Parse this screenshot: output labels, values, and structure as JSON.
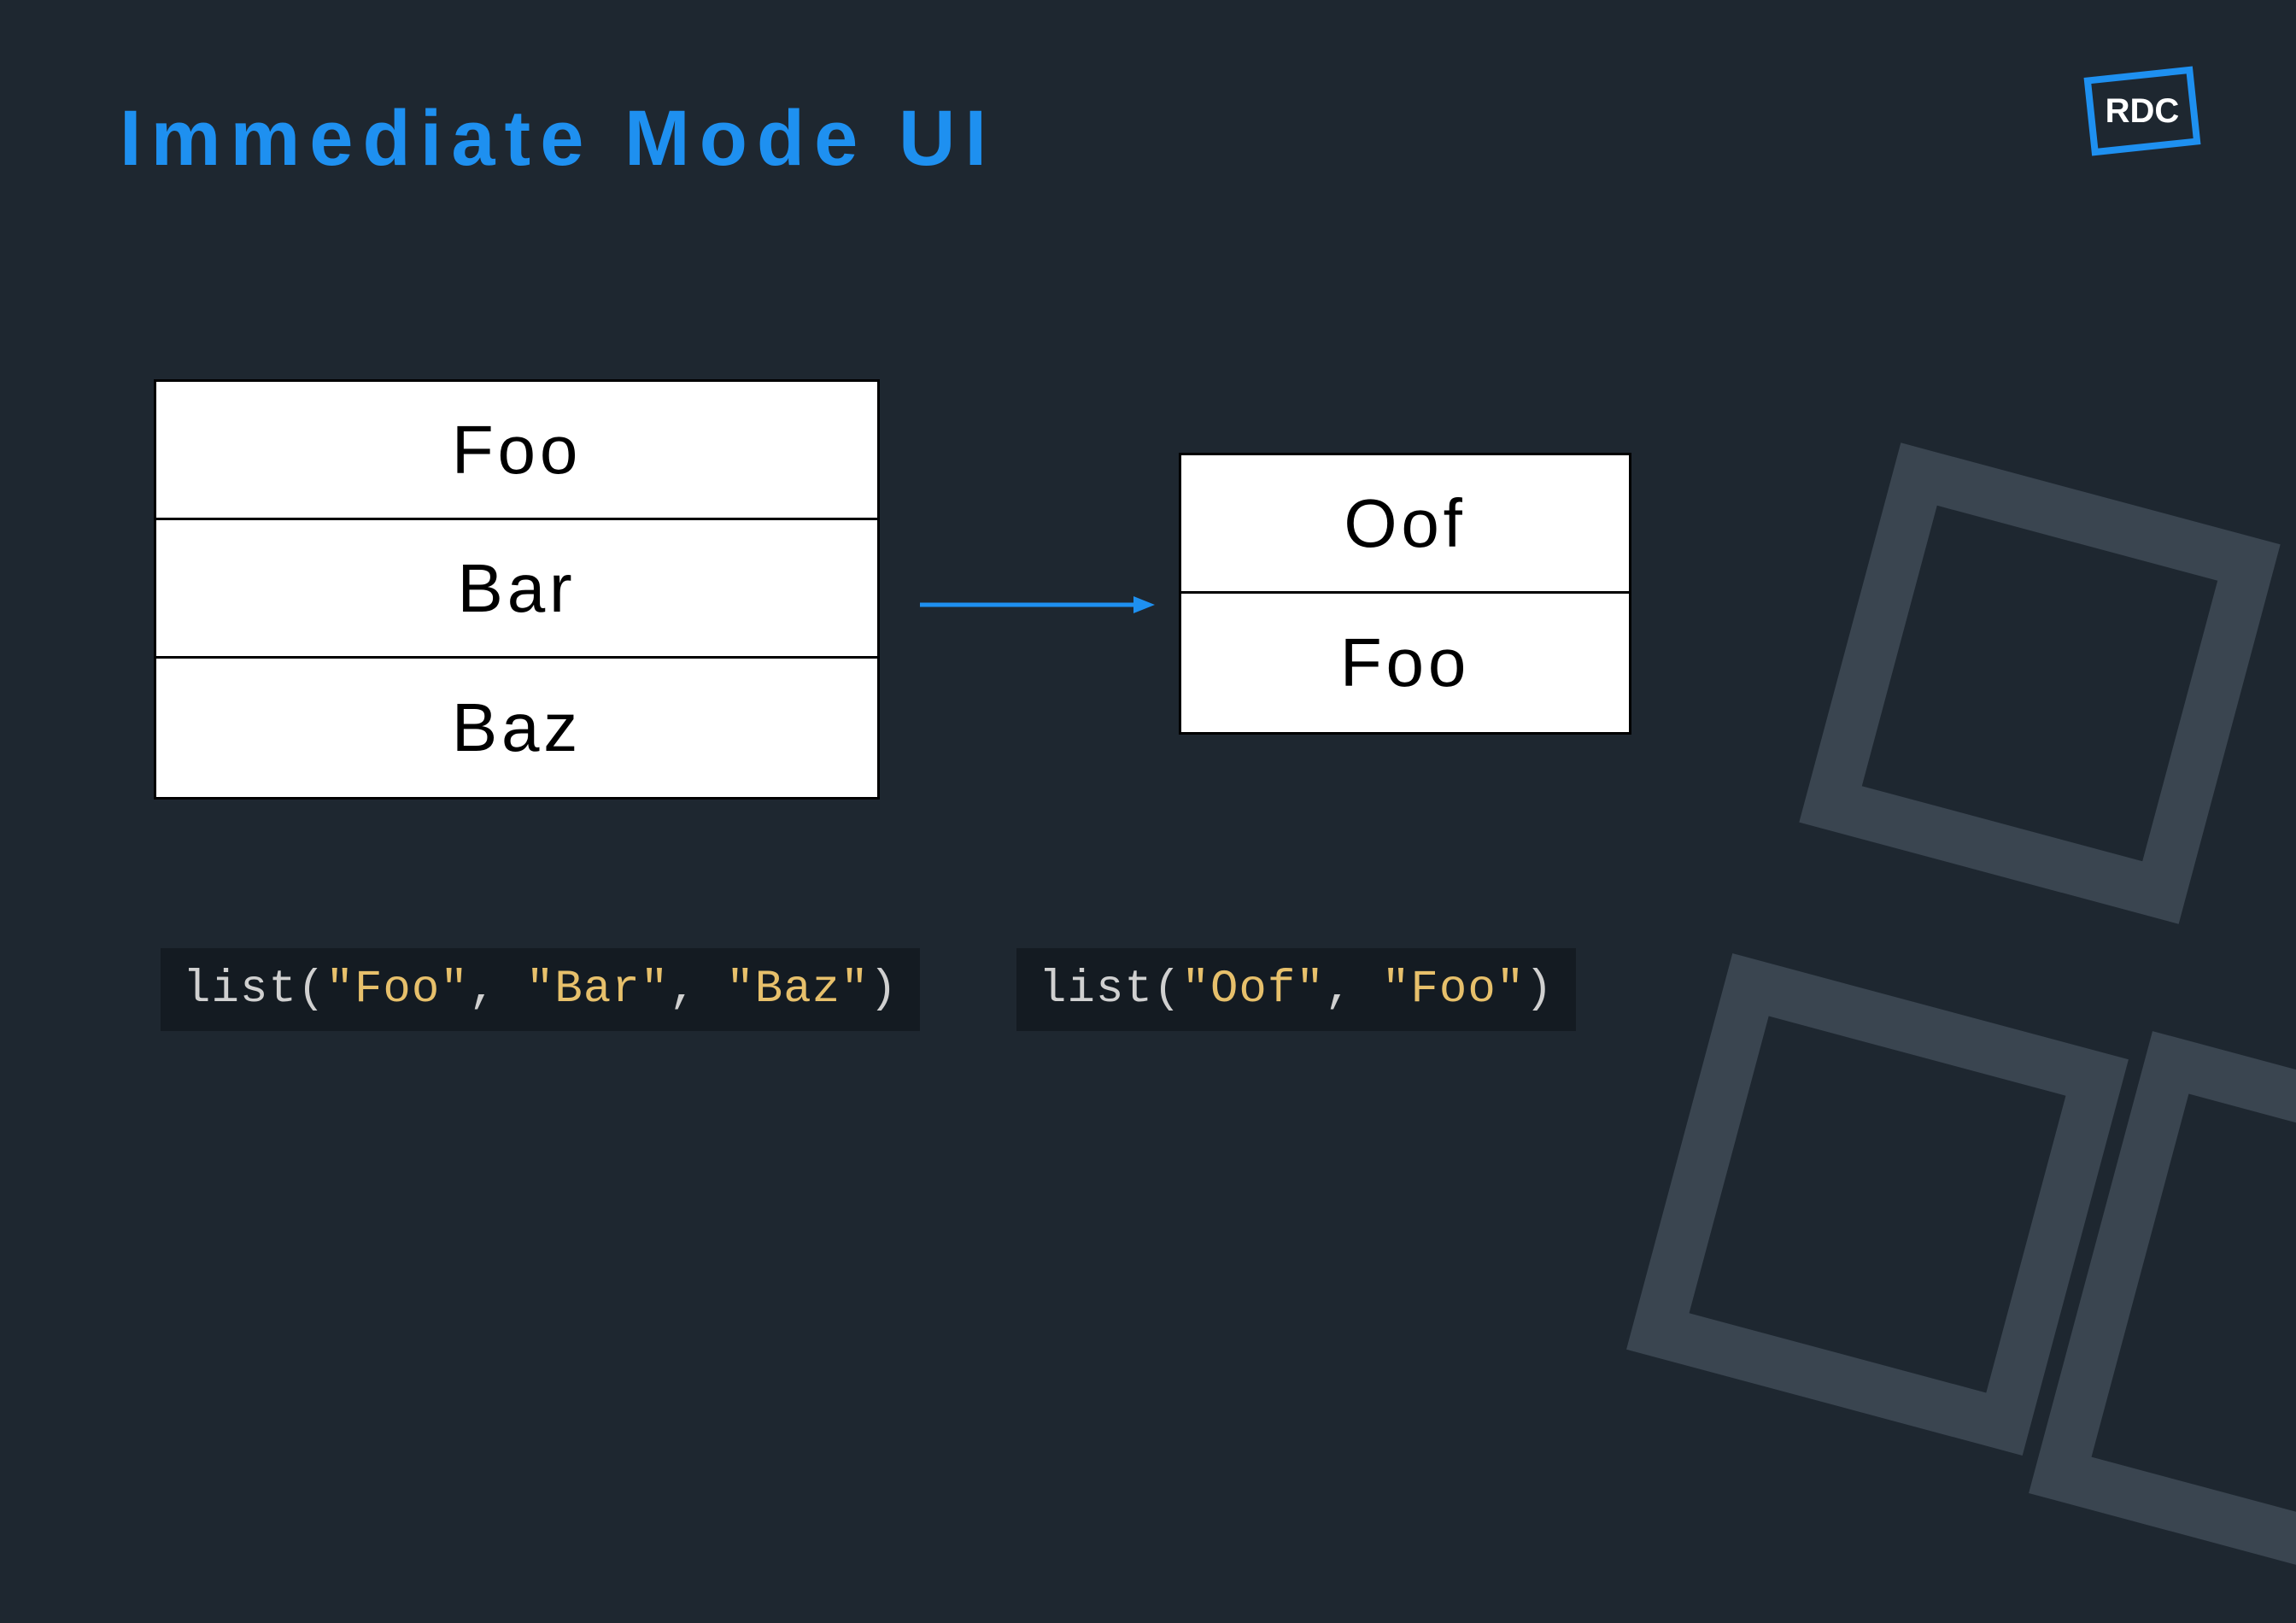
{
  "title": "Immediate Mode UI",
  "logo_text": "RDC",
  "left_list": {
    "items": [
      "Foo",
      "Bar",
      "Baz"
    ]
  },
  "right_list": {
    "items": [
      "Oof",
      "Foo"
    ]
  },
  "code_left": {
    "fn": "list",
    "args": [
      "\"Foo\"",
      "\"Bar\"",
      "\"Baz\""
    ]
  },
  "code_right": {
    "fn": "list",
    "args": [
      "\"Oof\"",
      "\"Foo\""
    ]
  },
  "colors": {
    "accent": "#1e90f0",
    "bg": "#1e2730",
    "code_bg": "#141b22",
    "code_str": "#e7c06b"
  }
}
